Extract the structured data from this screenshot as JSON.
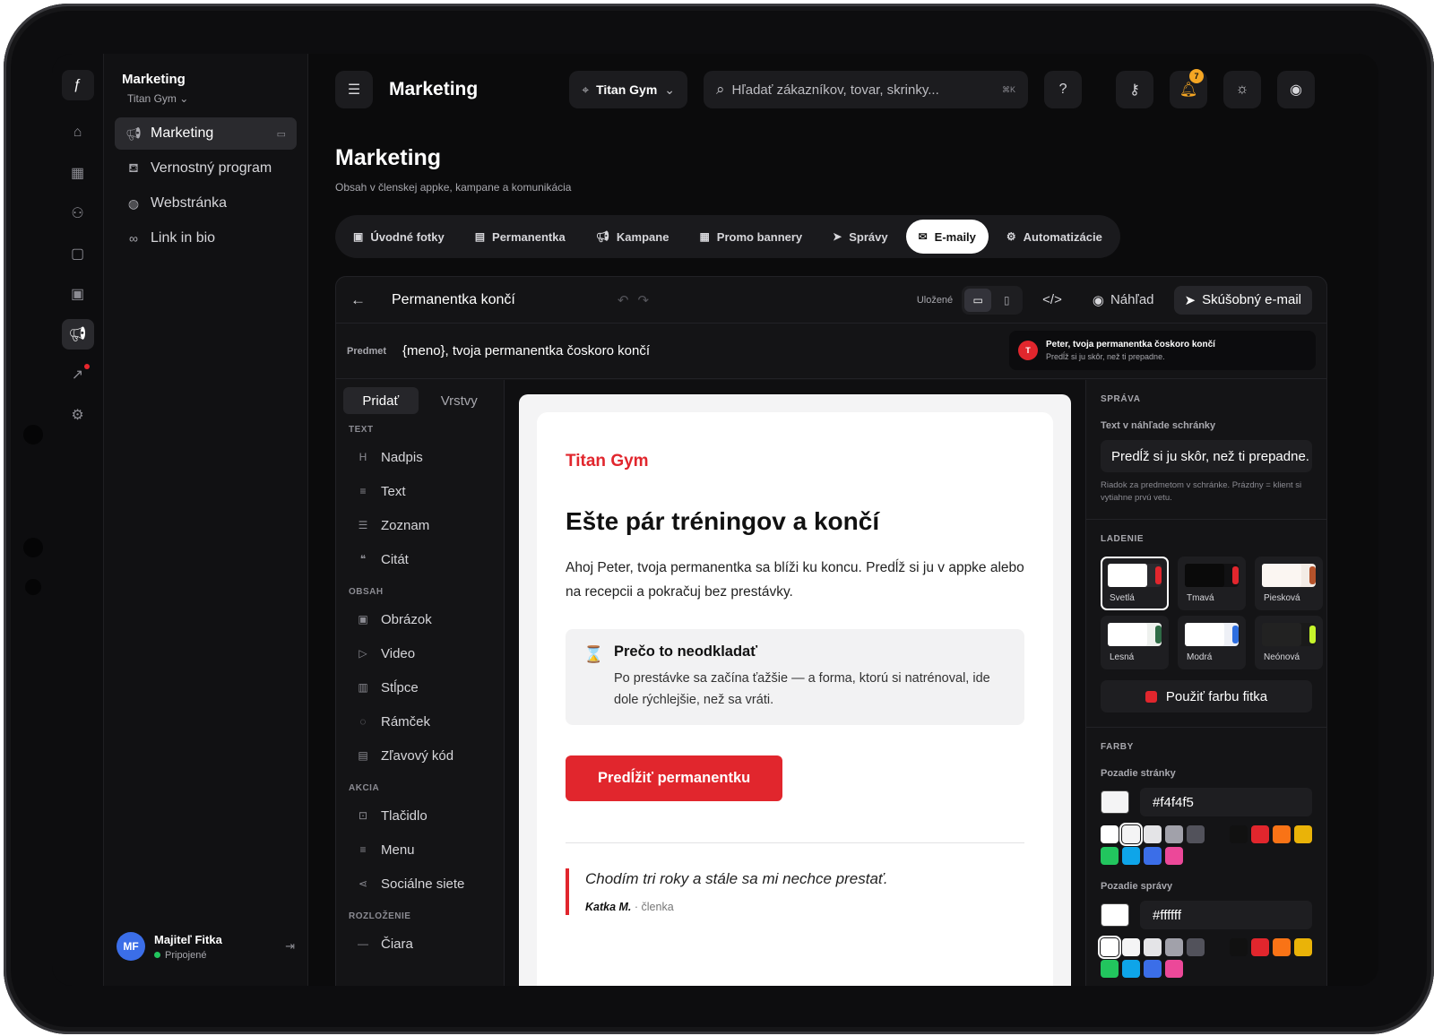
{
  "sidebar": {
    "title": "Marketing",
    "org": "Titan Gym",
    "items": [
      {
        "label": "Marketing",
        "icon": "megaphone-icon",
        "active": true
      },
      {
        "label": "Vernostný program",
        "icon": "stamp-icon"
      },
      {
        "label": "Webstránka",
        "icon": "globe-icon"
      },
      {
        "label": "Link in bio",
        "icon": "link-icon"
      }
    ],
    "user": {
      "initials": "MF",
      "name": "Majiteľ Fitka",
      "status": "Pripojené"
    }
  },
  "rail": [
    "logo-icon",
    "home-icon",
    "register-icon",
    "users-icon",
    "bag-icon",
    "calendar-icon",
    "megaphone-icon",
    "chart-icon",
    "gear-icon"
  ],
  "topbar": {
    "title": "Marketing",
    "location": "Titan Gym",
    "search_placeholder": "Hľadať zákazníkov, tovar, skrinky...",
    "shortcut": "⌘K",
    "notifications": "7"
  },
  "page": {
    "title": "Marketing",
    "subtitle": "Obsah v členskej appke, kampane a komunikácia"
  },
  "tabs": [
    {
      "label": "Úvodné fotky"
    },
    {
      "label": "Permanentka"
    },
    {
      "label": "Kampane"
    },
    {
      "label": "Promo bannery"
    },
    {
      "label": "Správy"
    },
    {
      "label": "E-maily",
      "active": true
    },
    {
      "label": "Automatizácie"
    }
  ],
  "editor": {
    "name": "Permanentka končí",
    "saved": "Uložené",
    "preview_btn": "Náhľad",
    "test_btn": "Skúšobný e-mail",
    "subject_label": "Predmet",
    "subject": "{meno}, tvoja permanentka čoskoro končí",
    "inbox_avatar": "T",
    "inbox_title": "Peter, tvoja permanentka čoskoro končí",
    "inbox_text": "Predĺž si ju skôr, než ti prepadne."
  },
  "blocks": {
    "tab_add": "Pridať",
    "tab_layers": "Vrstvy",
    "groups": [
      {
        "title": "TEXT",
        "items": [
          {
            "label": "Nadpis",
            "icon": "H"
          },
          {
            "label": "Text",
            "icon": "≡"
          },
          {
            "label": "Zoznam",
            "icon": "☰"
          },
          {
            "label": "Citát",
            "icon": "❝"
          }
        ]
      },
      {
        "title": "OBSAH",
        "items": [
          {
            "label": "Obrázok",
            "icon": "▣"
          },
          {
            "label": "Video",
            "icon": "▷"
          },
          {
            "label": "Stĺpce",
            "icon": "▥"
          },
          {
            "label": "Rámček",
            "icon": "◌"
          },
          {
            "label": "Zľavový kód",
            "icon": "▤"
          }
        ]
      },
      {
        "title": "AKCIA",
        "items": [
          {
            "label": "Tlačidlo",
            "icon": "⊡"
          },
          {
            "label": "Menu",
            "icon": "≡"
          },
          {
            "label": "Sociálne siete",
            "icon": "⋖"
          }
        ]
      },
      {
        "title": "ROZLOŽENIE",
        "items": [
          {
            "label": "Čiara",
            "icon": "—"
          }
        ]
      }
    ]
  },
  "email": {
    "brand": "Titan Gym",
    "heading": "Ešte pár tréningov a končí",
    "body": "Ahoj Peter, tvoja permanentka sa blíži ku koncu. Predĺž si ju v appke alebo na recepcii a pokračuj bez prestávky.",
    "callout_title": "Prečo to neodkladať",
    "callout_body": "Po prestávke sa začína ťažšie — a forma, ktorú si natrénoval, ide dole rýchlejšie, než sa vráti.",
    "cta": "Predĺžiť permanentku",
    "quote": "Chodím tri roky a stále sa mi nechce prestať.",
    "quote_author": "Katka M.",
    "quote_role": "· členka"
  },
  "settings": {
    "message_title": "SPRÁVA",
    "preheader_label": "Text v náhľade schránky",
    "preheader_value": "Predĺž si ju skôr, než ti prepadne.",
    "preheader_hint": "Riadok za predmetom v schránke. Prázdny = klient si vytiahne prvú vetu.",
    "theme_title": "LADENIE",
    "themes": [
      {
        "label": "Svetlá",
        "bg": "#2a2a2e",
        "inner": "#ffffff",
        "accent": "#e1262d",
        "active": true
      },
      {
        "label": "Tmavá",
        "bg": "#111113",
        "inner": "#0a0a0a",
        "accent": "#e1262d"
      },
      {
        "label": "Piesková",
        "bg": "#f3ece6",
        "inner": "#fbf6f2",
        "accent": "#b5532b"
      },
      {
        "label": "Lesná",
        "bg": "#eef1ee",
        "inner": "#ffffff",
        "accent": "#2f6b46"
      },
      {
        "label": "Modrá",
        "bg": "#eef0f6",
        "inner": "#ffffff",
        "accent": "#2f6fe0"
      },
      {
        "label": "Neónová",
        "bg": "#1a1a1a",
        "inner": "#222222",
        "accent": "#c6f42b"
      }
    ],
    "use_brand": "Použiť farbu fitka",
    "colors_title": "FARBY",
    "page_bg_label": "Pozadie stránky",
    "page_bg": "#f4f4f5",
    "msg_bg_label": "Pozadie správy",
    "msg_bg": "#ffffff",
    "palette": [
      "#ffffff",
      "#f4f4f5",
      "#e4e4e7",
      "#a1a1aa",
      "#52525b",
      "gap",
      "#111111",
      "#e1262d",
      "#f97316",
      "#eab308",
      "#22c55e",
      "#0ea5e9",
      "#3b6ee8",
      "#ec4899"
    ]
  }
}
